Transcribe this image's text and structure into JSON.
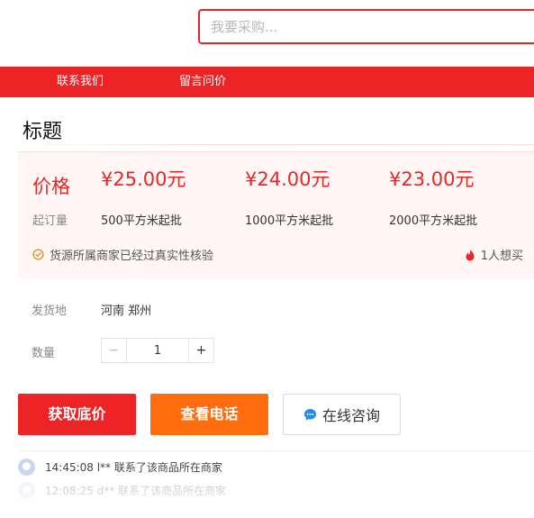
{
  "search": {
    "placeholder": "我要采购..."
  },
  "nav": {
    "items": [
      "联系我们",
      "留言问价"
    ]
  },
  "product": {
    "title": "标题"
  },
  "prices": {
    "label": "价格",
    "moq_label": "起订量",
    "tiers": [
      {
        "price": "¥25.00元",
        "qty": "500平方米起批"
      },
      {
        "price": "¥24.00元",
        "qty": "1000平方米起批"
      },
      {
        "price": "¥23.00元",
        "qty": "2000平方米起批"
      }
    ],
    "verify_text": "货源所属商家已经过真实性核验",
    "want_text": "1人想买"
  },
  "shipping": {
    "label": "发货地",
    "value": "河南 郑州"
  },
  "quantity": {
    "label": "数量",
    "value": "1",
    "minus": "−",
    "plus": "+"
  },
  "buttons": {
    "lowest_price": "获取底价",
    "phone": "查看电话",
    "consult": "在线咨询"
  },
  "activity": [
    {
      "text": "14:45:08 l** 联系了该商品所在商家"
    },
    {
      "text": "12:08:25 d** 联系了该商品所在商家"
    }
  ],
  "colors": {
    "brand": "#ee2326",
    "orange": "#ff6d0c",
    "price_bg": "#fff6f5"
  }
}
